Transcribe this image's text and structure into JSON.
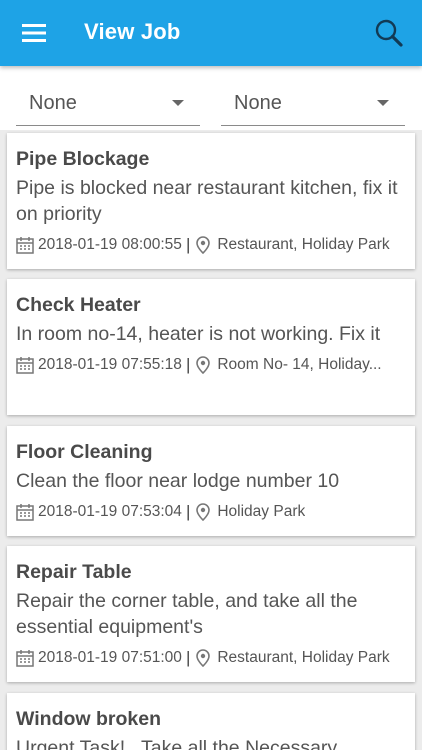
{
  "appbar": {
    "title": "View Job"
  },
  "filters": [
    {
      "value": "None"
    },
    {
      "value": "None"
    }
  ],
  "jobs": [
    {
      "title": "Pipe Blockage",
      "description": "Pipe is blocked near restaurant kitchen, fix it on priority",
      "datetime": "2018-01-19 08:00:55",
      "location": "Restaurant, Holiday Park"
    },
    {
      "title": "Check Heater",
      "description": "In room no-14, heater is not working. Fix it",
      "datetime": "2018-01-19 07:55:18",
      "location": " Room No- 14, Holiday..."
    },
    {
      "title": "Floor Cleaning",
      "description": "Clean the floor near lodge number 10",
      "datetime": "2018-01-19 07:53:04",
      "location": "Holiday Park"
    },
    {
      "title": "Repair Table",
      "description": "Repair the corner table, and take all the essential  equipment's",
      "datetime": "2018-01-19 07:51:00",
      "location": "Restaurant, Holiday Park"
    },
    {
      "title": "Window broken",
      "description": "Urgent Task! . Take all the Necessary",
      "datetime": "",
      "location": ""
    }
  ],
  "icons": {
    "menu": "menu-icon",
    "search": "search-icon",
    "date": "calendar-icon",
    "location": "location-pin-icon"
  },
  "colors": {
    "appbar": "#1ea3e6",
    "background": "#ececec"
  }
}
